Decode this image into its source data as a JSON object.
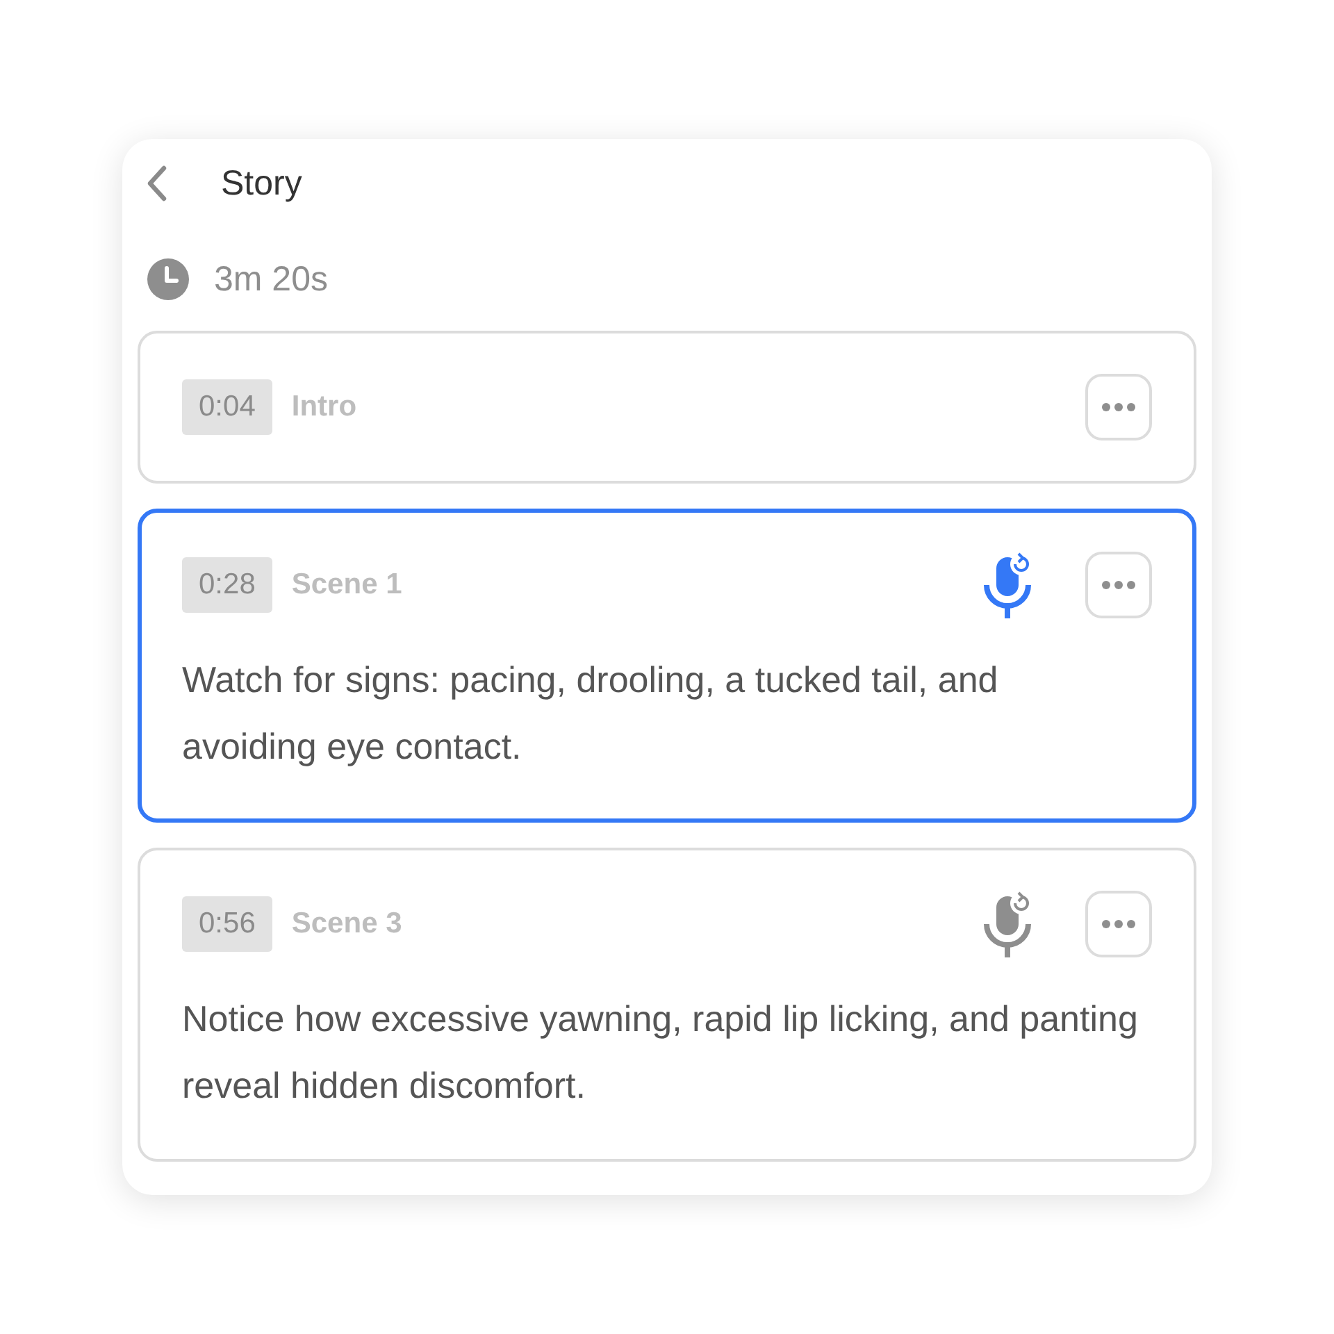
{
  "header": {
    "title": "Story"
  },
  "duration": "3m 20s",
  "scenes": [
    {
      "time": "0:04",
      "title": "Intro",
      "selected": false,
      "voiceover": false
    },
    {
      "time": "0:28",
      "title": "Scene 1",
      "selected": true,
      "voiceover": true,
      "text": "Watch for signs: pacing, drooling, a tucked tail, and avoiding eye contact."
    },
    {
      "time": "0:56",
      "title": "Scene 3",
      "selected": false,
      "voiceover": true,
      "text": "Notice how excessive yawning, rapid lip licking, and panting reveal hidden discomfort."
    }
  ]
}
